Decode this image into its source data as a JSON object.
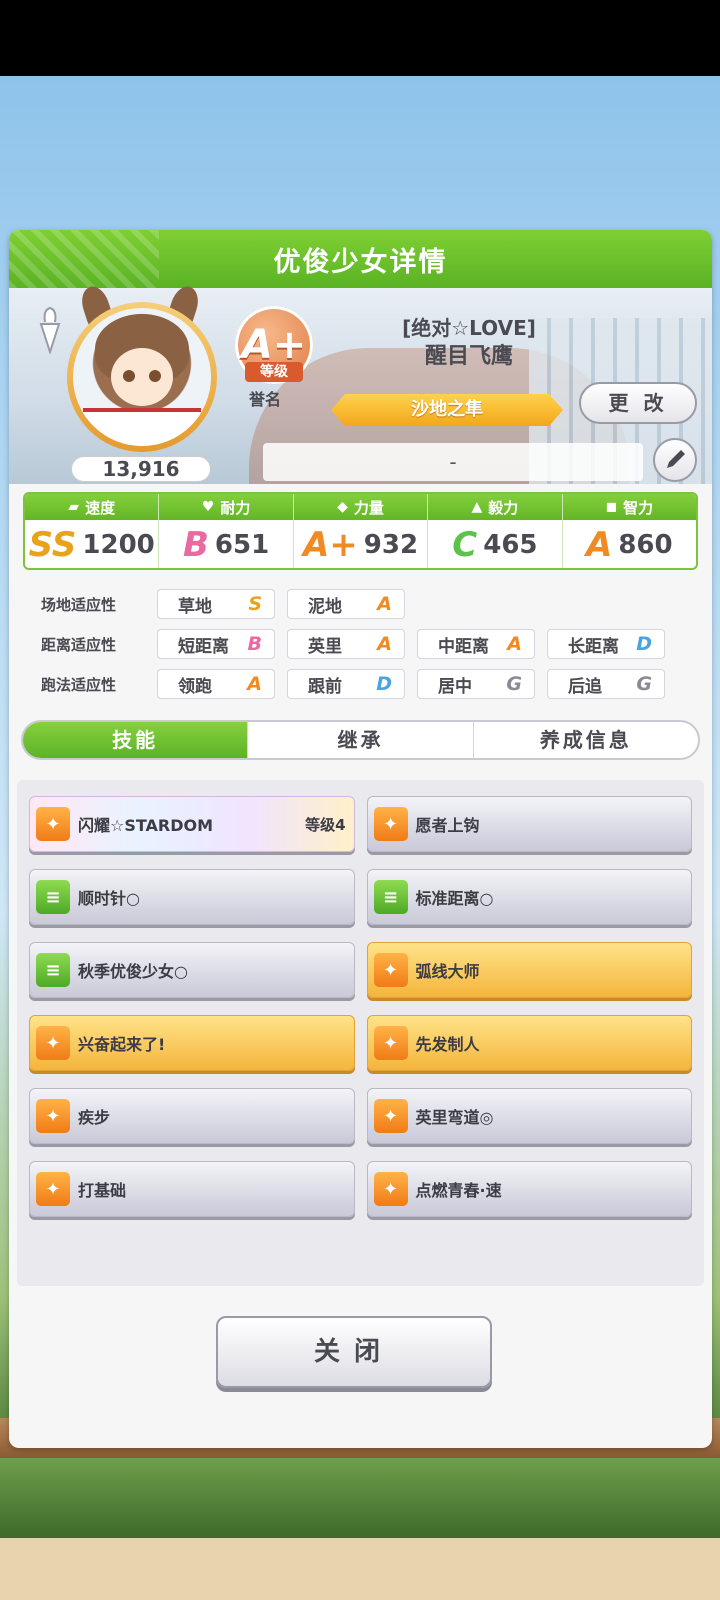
{
  "panel": {
    "title": "优俊少女详情"
  },
  "profile": {
    "fans": "13,916",
    "grade": "A+",
    "grade_label": "等级",
    "fame_label": "誉名",
    "epithet": "[绝对☆LOVE]",
    "name": "醒目飞鹰",
    "title": "沙地之隼",
    "change_button": "更 改",
    "memo": "-"
  },
  "stats": [
    {
      "label": "速度",
      "icon": "shoe-icon",
      "rank": "SS",
      "rank_color": "#e8a31a",
      "value": "1200"
    },
    {
      "label": "耐力",
      "icon": "heart-icon",
      "rank": "B",
      "rank_color": "#e86aa0",
      "value": "651"
    },
    {
      "label": "力量",
      "icon": "muscle-icon",
      "rank": "A+",
      "rank_color": "#f08a24",
      "value": "932"
    },
    {
      "label": "毅力",
      "icon": "flame-icon",
      "rank": "C",
      "rank_color": "#5cc34a",
      "value": "465"
    },
    {
      "label": "智力",
      "icon": "cap-icon",
      "rank": "A",
      "rank_color": "#f08a24",
      "value": "860"
    }
  ],
  "aptitude": {
    "surface": {
      "label": "场地适应性",
      "items": [
        {
          "name": "草地",
          "grade": "S"
        },
        {
          "name": "泥地",
          "grade": "A"
        }
      ]
    },
    "distance": {
      "label": "距离适应性",
      "items": [
        {
          "name": "短距离",
          "grade": "B"
        },
        {
          "name": "英里",
          "grade": "A"
        },
        {
          "name": "中距离",
          "grade": "A"
        },
        {
          "name": "长距离",
          "grade": "D"
        }
      ]
    },
    "strategy": {
      "label": "跑法适应性",
      "items": [
        {
          "name": "领跑",
          "grade": "A"
        },
        {
          "name": "跟前",
          "grade": "D"
        },
        {
          "name": "居中",
          "grade": "G"
        },
        {
          "name": "后追",
          "grade": "G"
        }
      ]
    }
  },
  "grade_colors": {
    "S": "#e8a31a",
    "A": "#f08a24",
    "B": "#e86aa0",
    "C": "#5cc34a",
    "D": "#4aa3e0",
    "G": "#8a8a96"
  },
  "tabs": [
    {
      "label": "技能",
      "active": true
    },
    {
      "label": "继承",
      "active": false
    },
    {
      "label": "养成信息",
      "active": false
    }
  ],
  "skills": [
    {
      "name": "闪耀☆STARDOM",
      "level": "等级4",
      "style": "rainbow",
      "icon": "orange"
    },
    {
      "name": "愿者上钩",
      "level": "",
      "style": "gray",
      "icon": "orange"
    },
    {
      "name": "顺时针○",
      "level": "",
      "style": "gray",
      "icon": "green"
    },
    {
      "name": "标准距离○",
      "level": "",
      "style": "gray",
      "icon": "green"
    },
    {
      "name": "秋季优俊少女○",
      "level": "",
      "style": "gray",
      "icon": "green"
    },
    {
      "name": "弧线大师",
      "level": "",
      "style": "gold",
      "icon": "orange"
    },
    {
      "name": "兴奋起来了!",
      "level": "",
      "style": "gold",
      "icon": "orange"
    },
    {
      "name": "先发制人",
      "level": "",
      "style": "gold",
      "icon": "orange"
    },
    {
      "name": "疾步",
      "level": "",
      "style": "gray",
      "icon": "orange"
    },
    {
      "name": "英里弯道◎",
      "level": "",
      "style": "gray",
      "icon": "orange"
    },
    {
      "name": "打基础",
      "level": "",
      "style": "gray",
      "icon": "orange"
    },
    {
      "name": "点燃青春·速",
      "level": "",
      "style": "gray",
      "icon": "orange"
    }
  ],
  "close_button": "关闭"
}
